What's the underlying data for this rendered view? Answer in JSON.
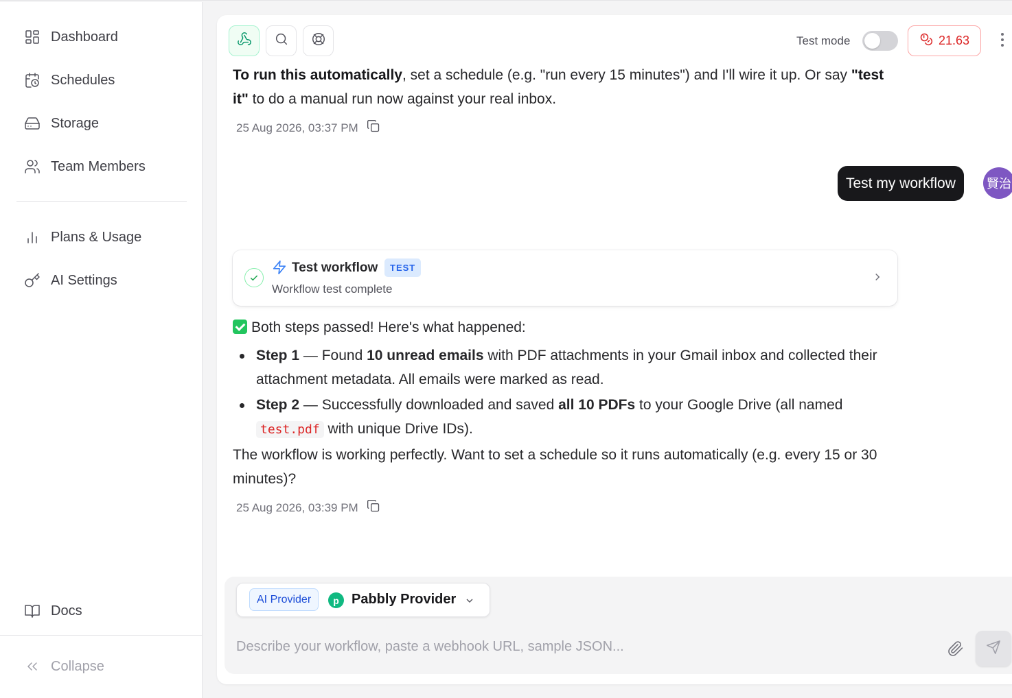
{
  "sidebar": {
    "items": [
      {
        "label": "Dashboard",
        "icon": "dashboard-icon"
      },
      {
        "label": "Schedules",
        "icon": "calendar-clock-icon"
      },
      {
        "label": "Storage",
        "icon": "storage-drive-icon"
      },
      {
        "label": "Team Members",
        "icon": "users-icon"
      },
      {
        "label": "Plans & Usage",
        "icon": "bar-chart-icon"
      },
      {
        "label": "AI Settings",
        "icon": "key-icon"
      }
    ],
    "docs_label": "Docs",
    "collapse_label": "Collapse"
  },
  "toolbar": {
    "test_mode_label": "Test mode",
    "test_mode_on": false,
    "credits": "21.63"
  },
  "messages": {
    "assistant1": {
      "bold1": "To run this automatically",
      "text1": ", set a schedule (e.g. \"run every 15 minutes\") and I'll wire it up. Or say ",
      "bold2": "\"test it\"",
      "text2": " to do a manual run now against your real inbox.",
      "timestamp": "25 Aug 2026, 03:37 PM"
    },
    "user1": {
      "text": "Test my workflow",
      "avatar": "賢治"
    },
    "tool_card": {
      "title": "Test workflow",
      "badge": "TEST",
      "subtitle": "Workflow test complete"
    },
    "assistant2": {
      "intro": "Both steps passed! Here's what happened:",
      "step1_label": "Step 1",
      "step1_a": " — Found ",
      "step1_bold": "10 unread emails",
      "step1_b": " with PDF attachments in your Gmail inbox and collected their attachment metadata. All emails were marked as read.",
      "step2_label": "Step 2",
      "step2_a": " — Successfully downloaded and saved ",
      "step2_bold": "all 10 PDFs",
      "step2_b": " to your Google Drive (all named ",
      "step2_code": "test.pdf",
      "step2_c": " with unique Drive IDs).",
      "outro": "The workflow is working perfectly. Want to set a schedule so it runs automatically (e.g. every 15 or 30 minutes)?",
      "timestamp": "25 Aug 2026, 03:39 PM"
    }
  },
  "composer": {
    "provider_pill": "AI Provider",
    "provider_name": "Pabbly Provider",
    "placeholder": "Describe your workflow, paste a webhook URL, sample JSON..."
  },
  "colors": {
    "accent_green": "#059669",
    "credits_red": "#dc2626",
    "badge_blue": "#2563eb",
    "avatar_purple": "#7e57c2"
  }
}
